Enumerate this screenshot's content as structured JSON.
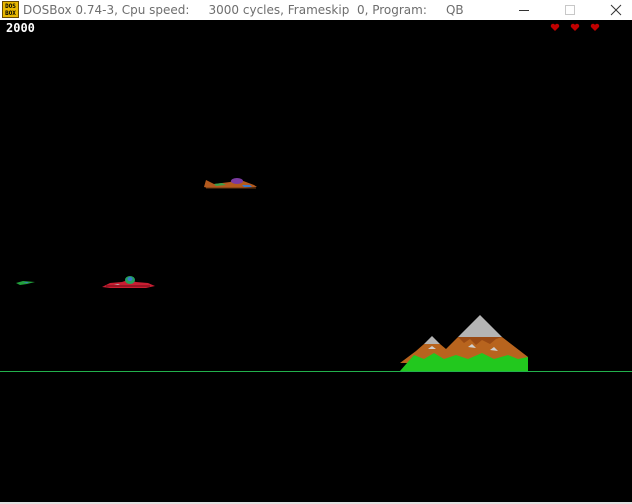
{
  "window": {
    "icon_text_line1": "DOS",
    "icon_text_line2": "BOX",
    "title": "DOSBox 0.74-3, Cpu speed:     3000 cycles, Frameskip  0, Program:     QB",
    "minimize_icon": "minimize-icon",
    "maximize_icon": "maximize-icon",
    "close_icon": "close-icon"
  },
  "game": {
    "score": "2000",
    "lives": 3,
    "colors": {
      "background": "#000000",
      "ground": "#22b14c",
      "heart": "#c00000",
      "mountain_snow": "#b4b4b4",
      "mountain_rock": "#b8641e",
      "mountain_grass": "#22c81e",
      "enemy_ship": "#b45a1e",
      "player_ship": "#c81e32"
    }
  }
}
